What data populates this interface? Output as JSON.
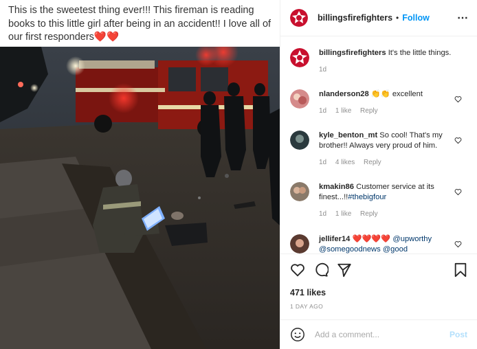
{
  "image_caption": "This is the sweetest thing ever!!! This fireman is reading books to this little girl after being in an accident!! I love all of our first responders❤️❤️",
  "header": {
    "username": "billingsfirefighters",
    "separator": "•",
    "follow_label": "Follow",
    "more_label": "⋯"
  },
  "post_caption": {
    "username": "billingsfirefighters",
    "text": "It's the little things.",
    "time": "1d"
  },
  "comments": [
    {
      "username": "nlanderson28",
      "text": "👏👏 excellent",
      "time": "1d",
      "likes": "1 like",
      "reply": "Reply"
    },
    {
      "username": "kyle_benton_mt",
      "text": "So cool! That's my brother!! Always very proud of him.",
      "time": "1d",
      "likes": "4 likes",
      "reply": "Reply"
    },
    {
      "username": "kmakin86",
      "text": "Customer service at its finest...!!",
      "tag": "#thebigfour",
      "time": "1d",
      "likes": "1 like",
      "reply": "Reply"
    },
    {
      "username": "jellifer14",
      "text": "❤️❤️❤️❤️",
      "tag": "@upworthy",
      "tag2": "@somegoodnews @good"
    }
  ],
  "likes": "471 likes",
  "date": "1 DAY AGO",
  "add_comment": {
    "placeholder": "Add a comment...",
    "post_label": "Post"
  },
  "icons": [
    "fire-department-logo-icon",
    "heart-icon",
    "comment-icon",
    "share-icon",
    "bookmark-icon",
    "emoji-icon",
    "more-icon"
  ]
}
